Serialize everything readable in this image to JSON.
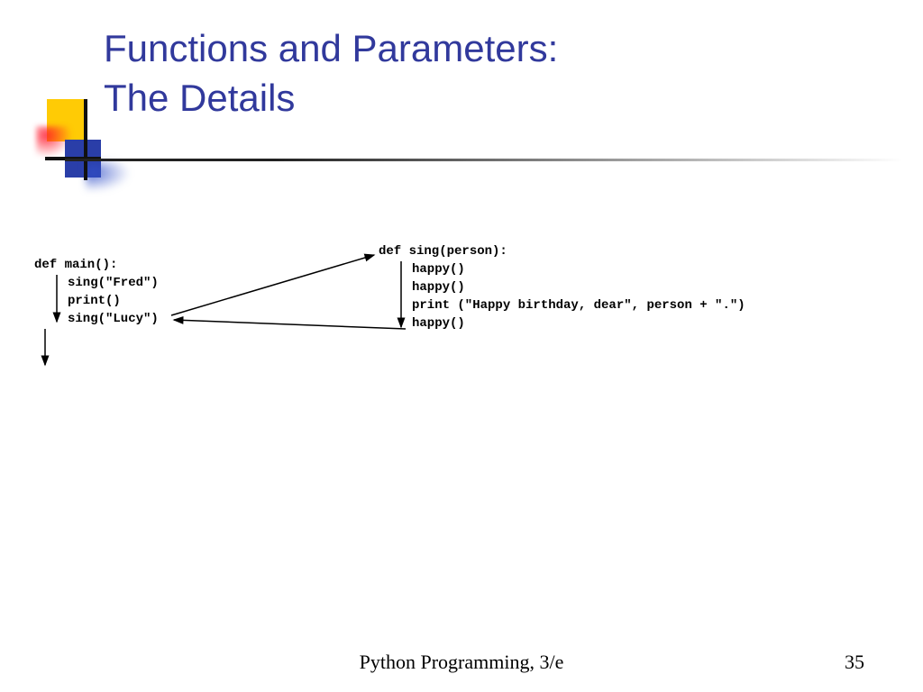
{
  "title_line1": "Functions and Parameters:",
  "title_line2": "The Details",
  "left_block": {
    "l1": "def main():",
    "l2": "sing(\"Fred\")",
    "l3": "print()",
    "l4": "sing(\"Lucy\")"
  },
  "right_block": {
    "l1": "def sing(person):",
    "l2": "happy()",
    "l3": "happy()",
    "l4": "print (\"Happy birthday, dear\", person + \".\")",
    "l5": "happy()"
  },
  "footer": "Python Programming, 3/e",
  "page": "35"
}
